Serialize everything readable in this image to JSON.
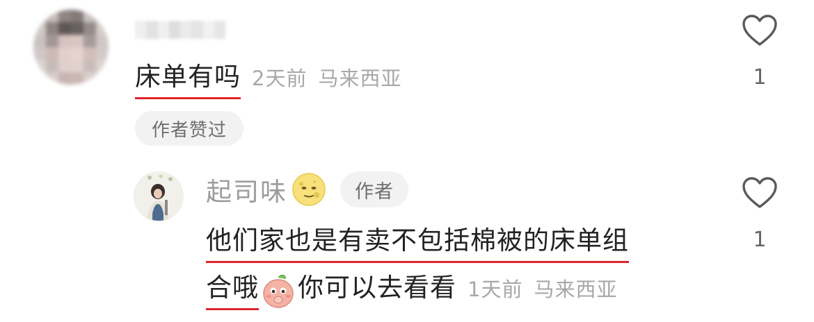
{
  "comment": {
    "username": "",
    "text": "床单有吗",
    "time": "2天前",
    "location": "马来西亚",
    "author_liked_badge": "作者赞过",
    "like_count": "1",
    "avatar_icon": "blurred-avatar",
    "like_icon": "heart-outline-icon"
  },
  "reply": {
    "username": "起司味",
    "name_emoji": "moon-face-emoji",
    "author_badge": "作者",
    "text_line1": "他们家也是有卖不包括棉被的床单组",
    "text_line2_start": "合哦",
    "inline_emoji": "peach-thinking-emoji",
    "text_line2_end": "你可以去看看",
    "time": "1天前",
    "location": "马来西亚",
    "like_count": "1",
    "like_icon": "heart-outline-icon"
  },
  "colors": {
    "underline": "#e0232b",
    "meta_text": "#a8a8a8",
    "badge_bg": "#f2f2f2"
  }
}
